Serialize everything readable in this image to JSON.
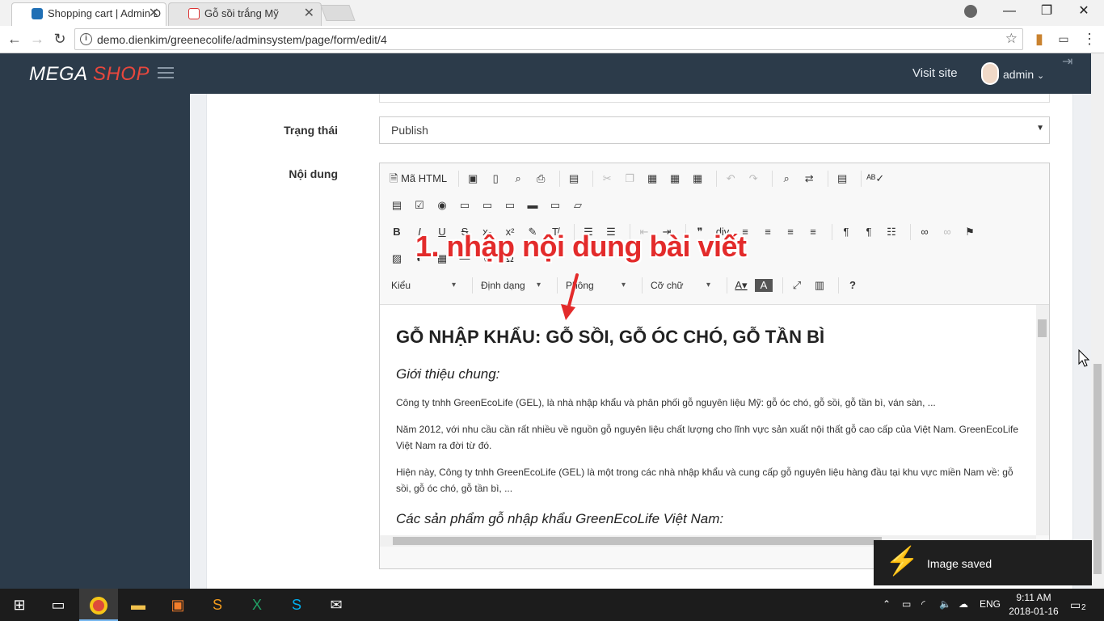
{
  "browser": {
    "tabs": [
      {
        "title": "Shopping cart | Admin D",
        "active": true
      },
      {
        "title": "Gỗ sồi trắng Mỹ",
        "active": false
      }
    ],
    "url": "demo.dienkim/greenecolife/adminsystem/page/form/edit/4"
  },
  "header": {
    "logo_mega": "MEGA",
    "logo_shop": "SHOP",
    "visit_site": "Visit site",
    "user": "admin"
  },
  "form": {
    "status_label": "Trạng thái",
    "status_value": "Publish",
    "content_label": "Nội dung"
  },
  "editor": {
    "toolbar": {
      "source_label": "Mã HTML",
      "style_combo": "Kiểu",
      "format_combo": "Định dạng",
      "font_combo": "Phông",
      "size_combo": "Cỡ chữ"
    },
    "content": {
      "heading": "GỖ NHẬP KHẨU: GỖ SỒI, GỖ ÓC CHÓ, GỖ TẦN BÌ",
      "intro_heading": "Giới thiệu chung:",
      "para1": "Công ty tnhh GreenEcoLife (GEL), là nhà nhập khẩu và phân phối gỗ nguyên liệu Mỹ: gỗ óc chó, gỗ sồi, gỗ tần bì, ván sàn, ...",
      "para2": "Năm 2012, với nhu cầu cần rất nhiều về nguồn gỗ nguyên liệu chất lượng cho lĩnh vực sản xuất nội thất gỗ cao cấp của Việt Nam. GreenEcoLife Việt Nam ra đời từ đó.",
      "para3": "Hiện này, Công ty tnhh GreenEcoLife (GEL) là một trong các nhà nhập khẩu và cung cấp gỗ nguyên liệu hàng đầu tại khu vực miền Nam về: gỗ sồi, gỗ óc chó, gỗ tần bì, ...",
      "products_heading": "Các sản phẩm gỗ nhập khẩu GreenEcoLife Việt Nam:"
    }
  },
  "annotation": "1. nhập nội dung bài viết",
  "toast": "Image saved",
  "taskbar": {
    "lang": "ENG",
    "time": "9:11 AM",
    "date": "2018-01-16",
    "notifications": "2"
  },
  "colors": {
    "header_bg": "#2c3b4a",
    "brand_accent": "#e8473d",
    "annotation": "#e32b2b"
  }
}
